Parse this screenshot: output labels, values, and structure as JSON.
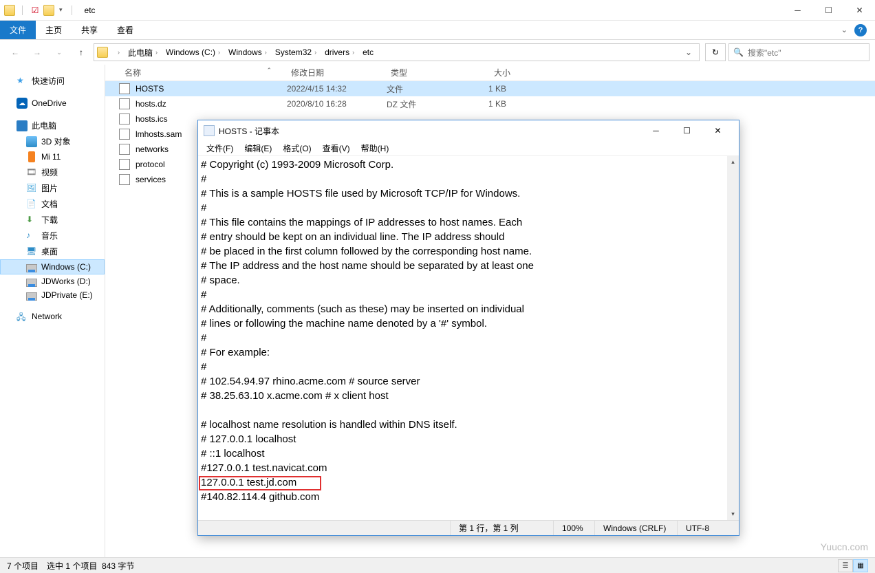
{
  "window": {
    "title": "etc"
  },
  "ribbon": {
    "file": "文件",
    "home": "主页",
    "share": "共享",
    "view": "查看"
  },
  "breadcrumb": {
    "root": "此电脑",
    "c": "Windows (C:)",
    "win": "Windows",
    "sys32": "System32",
    "drv": "drivers",
    "etc": "etc"
  },
  "search": {
    "placeholder": "搜索\"etc\""
  },
  "sidebar": {
    "quick": "快速访问",
    "onedrive": "OneDrive",
    "thispc": "此电脑",
    "d3d": "3D 对象",
    "mi11": "Mi 11",
    "video": "视频",
    "pictures": "图片",
    "documents": "文档",
    "downloads": "下载",
    "music": "音乐",
    "desktop": "桌面",
    "winc": "Windows (C:)",
    "jdworks": "JDWorks (D:)",
    "jdprivate": "JDPrivate (E:)",
    "network": "Network"
  },
  "columns": {
    "name": "名称",
    "date": "修改日期",
    "type": "类型",
    "size": "大小"
  },
  "files": [
    {
      "name": "HOSTS",
      "date": "2022/4/15 14:32",
      "type": "文件",
      "size": "1 KB",
      "selected": true
    },
    {
      "name": "hosts.dz",
      "date": "2020/8/10 16:28",
      "type": "DZ 文件",
      "size": "1 KB"
    },
    {
      "name": "hosts.ics",
      "date": "",
      "type": "",
      "size": ""
    },
    {
      "name": "lmhosts.sam",
      "date": "",
      "type": "",
      "size": ""
    },
    {
      "name": "networks",
      "date": "",
      "type": "",
      "size": ""
    },
    {
      "name": "protocol",
      "date": "",
      "type": "",
      "size": ""
    },
    {
      "name": "services",
      "date": "",
      "type": "",
      "size": ""
    }
  ],
  "statusbar": {
    "items": "7 个项目",
    "selected": "选中 1 个项目",
    "size": "843 字节"
  },
  "notepad": {
    "title": "HOSTS - 记事本",
    "menu": {
      "file": "文件(F)",
      "edit": "编辑(E)",
      "format": "格式(O)",
      "view": "查看(V)",
      "help": "帮助(H)"
    },
    "content": "# Copyright (c) 1993-2009 Microsoft Corp.\n#\n# This is a sample HOSTS file used by Microsoft TCP/IP for Windows.\n#\n# This file contains the mappings of IP addresses to host names. Each\n# entry should be kept on an individual line. The IP address should\n# be placed in the first column followed by the corresponding host name.\n# The IP address and the host name should be separated by at least one\n# space.\n#\n# Additionally, comments (such as these) may be inserted on individual\n# lines or following the machine name denoted by a '#' symbol.\n#\n# For example:\n#\n# 102.54.94.97 rhino.acme.com # source server\n# 38.25.63.10 x.acme.com # x client host\n\n# localhost name resolution is handled within DNS itself.\n# 127.0.0.1 localhost\n# ::1 localhost\n#127.0.0.1 test.navicat.com\n127.0.0.1 test.jd.com\n#140.82.114.4 github.com",
    "status": {
      "pos": "第 1 行，第 1 列",
      "zoom": "100%",
      "eol": "Windows (CRLF)",
      "enc": "UTF-8"
    }
  },
  "watermark": "Yuucn.com"
}
